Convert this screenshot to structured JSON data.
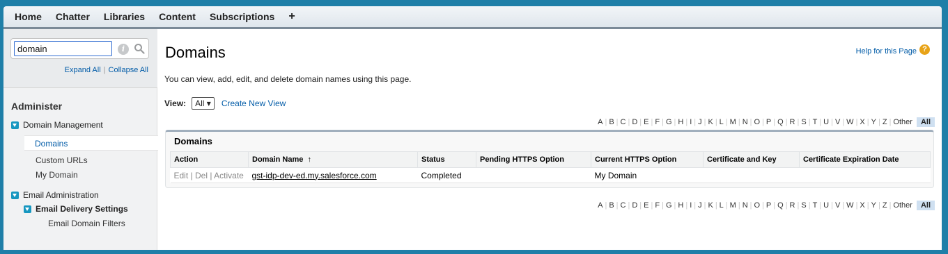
{
  "nav": {
    "tabs": [
      "Home",
      "Chatter",
      "Libraries",
      "Content",
      "Subscriptions"
    ],
    "add_tab": "+"
  },
  "sidebar": {
    "search_value": "domain",
    "expand_all": "Expand All",
    "separator": "|",
    "collapse_all": "Collapse All",
    "section_title": "Administer",
    "tree": {
      "domain_management": "Domain Management",
      "domains": "Domains",
      "custom_urls": "Custom URLs",
      "my_domain": "My Domain",
      "email_administration": "Email Administration",
      "email_delivery_settings": "Email Delivery Settings",
      "email_domain_filters": "Email Domain Filters"
    }
  },
  "main": {
    "title": "Domains",
    "help_link": "Help for this Page",
    "help_icon": "?",
    "description": "You can view, add, edit, and delete domain names using this page.",
    "view_label": "View:",
    "view_selected": "All",
    "create_view": "Create New View",
    "alphabet": [
      "A",
      "B",
      "C",
      "D",
      "E",
      "F",
      "G",
      "H",
      "I",
      "J",
      "K",
      "L",
      "M",
      "N",
      "O",
      "P",
      "Q",
      "R",
      "S",
      "T",
      "U",
      "V",
      "W",
      "X",
      "Y",
      "Z",
      "Other"
    ],
    "alphabet_all": "All",
    "list_title": "Domains",
    "columns": {
      "action": "Action",
      "domain_name": "Domain Name",
      "sort_indicator": "↑",
      "status": "Status",
      "pending_https": "Pending HTTPS Option",
      "current_https": "Current HTTPS Option",
      "cert_key": "Certificate and Key",
      "cert_exp": "Certificate Expiration Date"
    },
    "rows": [
      {
        "edit": "Edit",
        "del": "Del",
        "activate": "Activate",
        "domain_name": "gst-idp-dev-ed.my.salesforce.com",
        "status": "Completed",
        "pending_https": "",
        "current_https": "My Domain",
        "cert_key": "",
        "cert_exp": ""
      }
    ]
  },
  "colors": {
    "background": "#1f7fa8",
    "link": "#015ba7",
    "tree_icon": "#1797c0",
    "help_icon": "#e8a317"
  }
}
